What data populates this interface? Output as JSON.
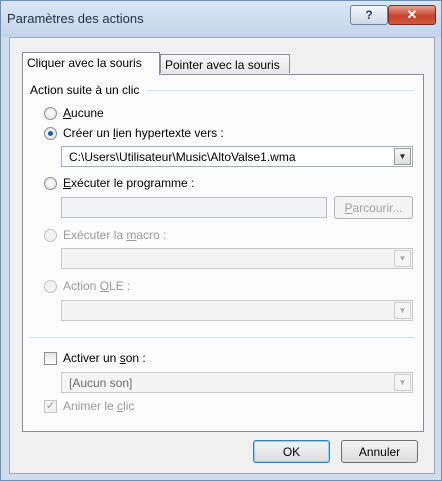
{
  "window": {
    "title": "Paramètres des actions",
    "help_glyph": "?",
    "close_glyph": "✕"
  },
  "tabs": [
    {
      "label": "Cliquer avec la souris",
      "active": true
    },
    {
      "label": "Pointer avec la souris",
      "active": false
    }
  ],
  "group": {
    "label": "Action suite à un clic"
  },
  "options": {
    "none": {
      "label": "Aucune",
      "hotkey": "A",
      "rest": "ucune"
    },
    "hyperlink": {
      "pre": "Créer un ",
      "hotkey": "l",
      "post": "ien hypertexte vers :",
      "value": "C:\\Users\\Utilisateur\\Music\\AltoValse1.wma"
    },
    "run_program": {
      "hotkey": "E",
      "post": "xécuter le programme :",
      "browse_pre": "",
      "browse_hotkey": "P",
      "browse_post": "arcourir..."
    },
    "run_macro": {
      "pre": "Exécuter la ",
      "hotkey": "m",
      "post": "acro :"
    },
    "ole": {
      "pre": "Action ",
      "hotkey": "O",
      "post": "LE :"
    }
  },
  "sound": {
    "pre": "Activer un ",
    "hotkey": "s",
    "post": "on :",
    "value": "[Aucun son]",
    "checked": false
  },
  "animate": {
    "pre": "Animer le ",
    "hotkey": "c",
    "post": "lic",
    "checked": true
  },
  "buttons": {
    "ok": "OK",
    "cancel": "Annuler"
  },
  "icons": {
    "dropdown": "▼",
    "check": "✓"
  }
}
